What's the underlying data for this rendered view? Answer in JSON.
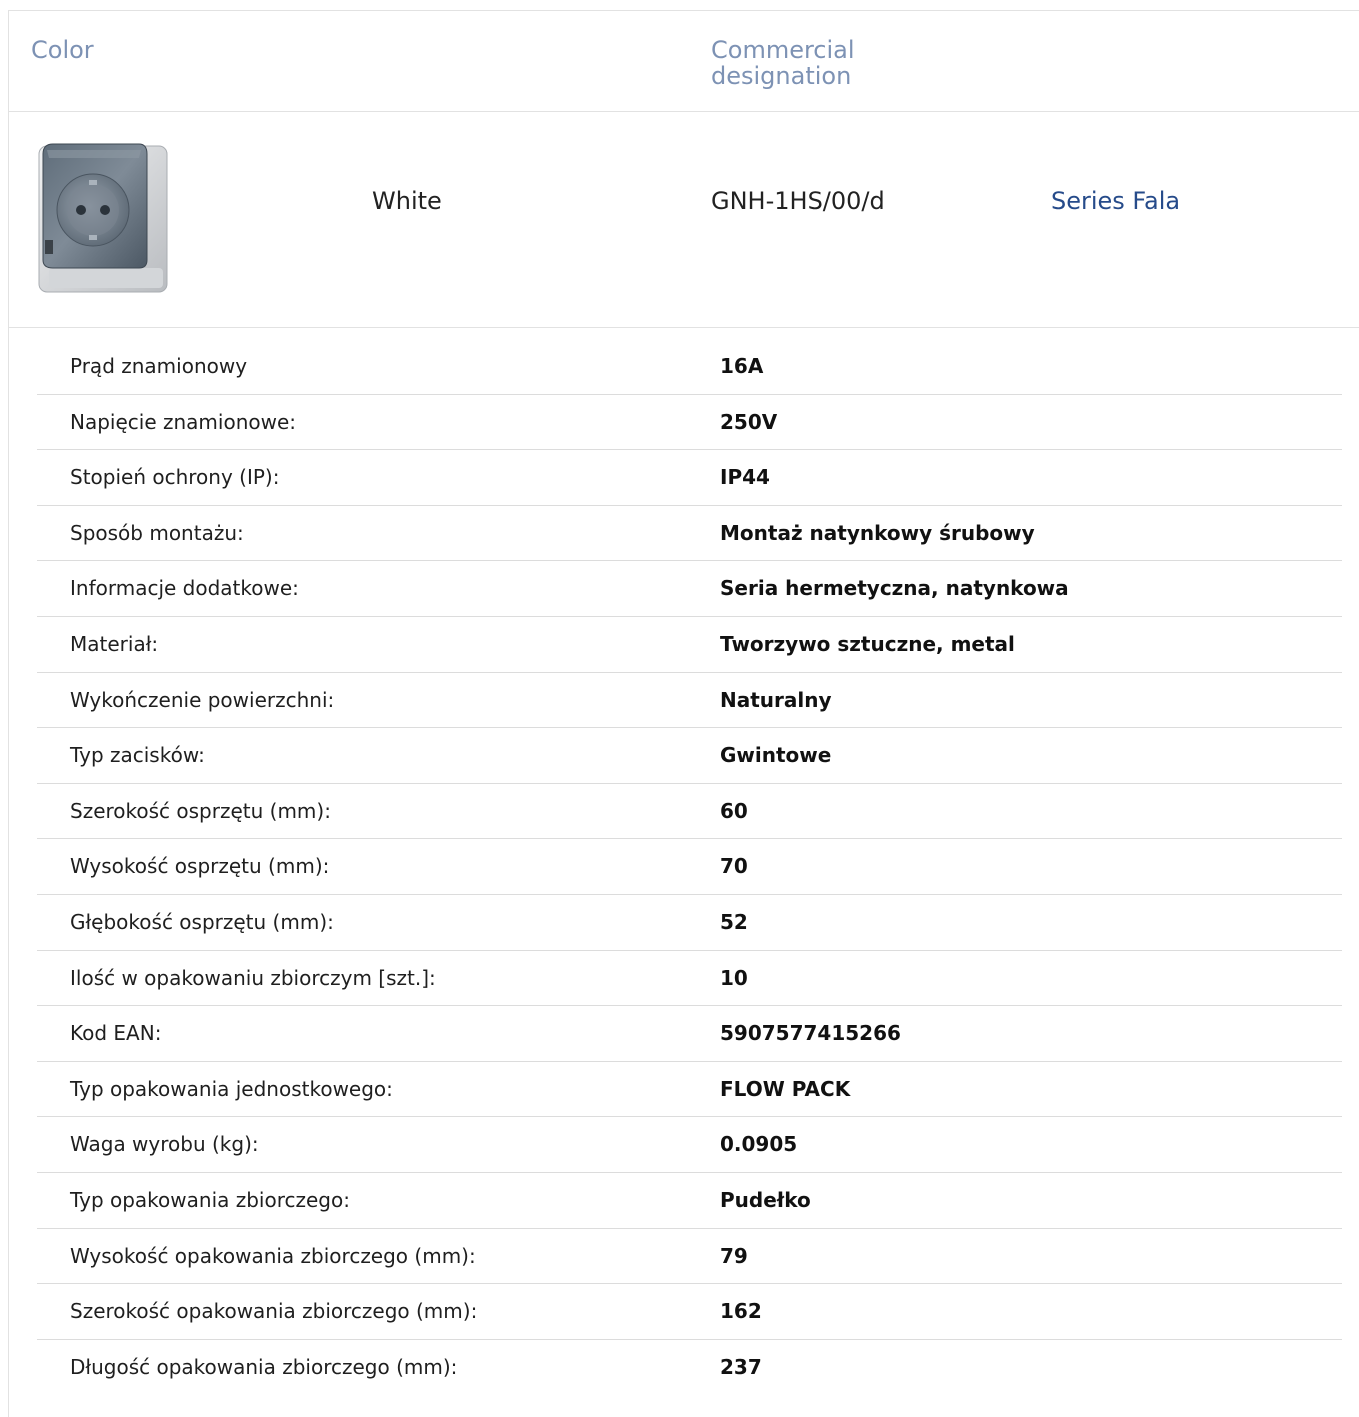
{
  "header": {
    "color_label": "Color",
    "designation_label": "Commercial designation"
  },
  "product": {
    "image_icon": "weatherproof-socket-image",
    "color": "White",
    "code": "GNH-1HS/00/d",
    "series": "Series Fala"
  },
  "specs": [
    {
      "label": "Prąd znamionowy",
      "value": "16A"
    },
    {
      "label": "Napięcie znamionowe:",
      "value": "250V"
    },
    {
      "label": "Stopień ochrony (IP):",
      "value": "IP44"
    },
    {
      "label": "Sposób montażu:",
      "value": "Montaż natynkowy śrubowy"
    },
    {
      "label": "Informacje dodatkowe:",
      "value": "Seria hermetyczna, natynkowa"
    },
    {
      "label": "Materiał:",
      "value": "Tworzywo sztuczne, metal"
    },
    {
      "label": "Wykończenie powierzchni:",
      "value": "Naturalny"
    },
    {
      "label": "Typ zacisków:",
      "value": "Gwintowe"
    },
    {
      "label": "Szerokość osprzętu (mm):",
      "value": "60"
    },
    {
      "label": "Wysokość osprzętu (mm):",
      "value": "70"
    },
    {
      "label": "Głębokość osprzętu (mm):",
      "value": "52"
    },
    {
      "label": "Ilość w opakowaniu zbiorczym [szt.]:",
      "value": "10"
    },
    {
      "label": "Kod EAN:",
      "value": "5907577415266"
    },
    {
      "label": "Typ opakowania jednostkowego:",
      "value": "FLOW PACK"
    },
    {
      "label": "Waga wyrobu (kg):",
      "value": "0.0905"
    },
    {
      "label": "Typ opakowania zbiorczego:",
      "value": "Pudełko"
    },
    {
      "label": "Wysokość opakowania zbiorczego (mm):",
      "value": "79"
    },
    {
      "label": "Szerokość opakowania zbiorczego (mm):",
      "value": "162"
    },
    {
      "label": "Długość opakowania zbiorczego (mm):",
      "value": "237"
    }
  ]
}
